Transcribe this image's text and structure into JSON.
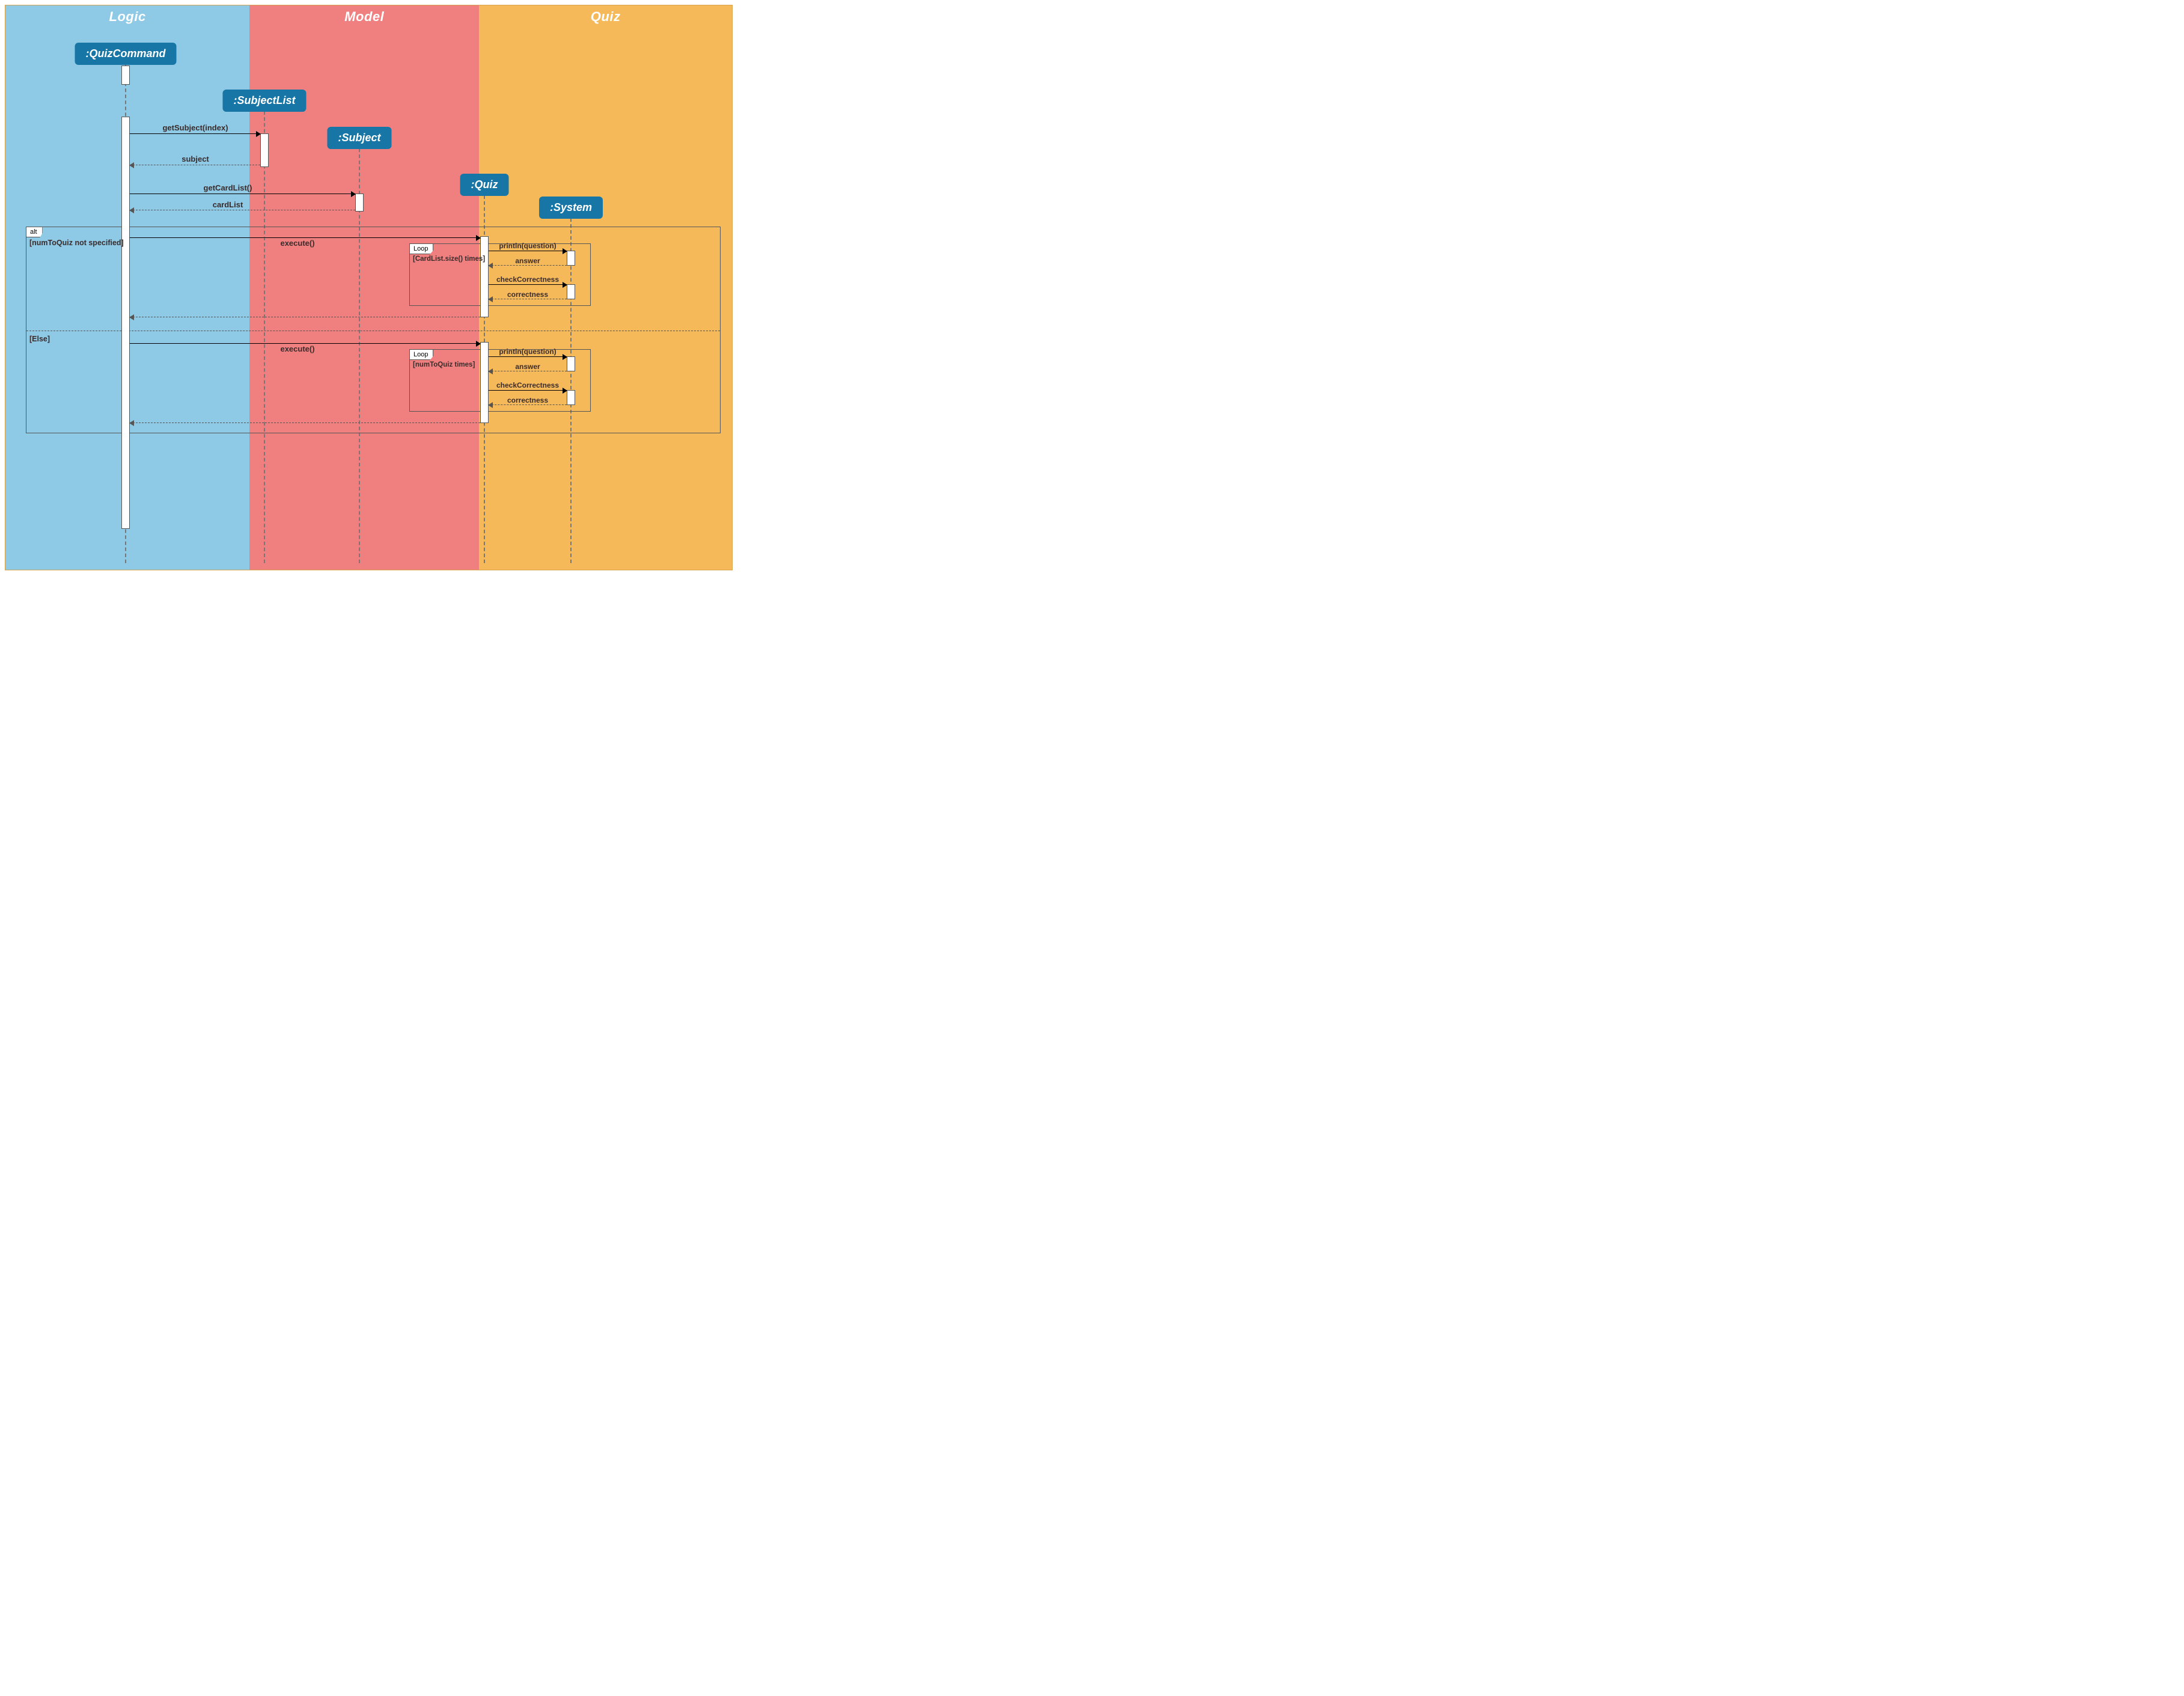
{
  "lanes": {
    "logic": "Logic",
    "model": "Model",
    "quiz": "Quiz"
  },
  "participants": {
    "quizCommand": ":QuizCommand",
    "subjectList": ":SubjectList",
    "subject": ":Subject",
    "quizObj": ":Quiz",
    "system": ":System"
  },
  "messages": {
    "getSubject": "getSubject(index)",
    "subjectRet": "subject",
    "getCardList": "getCardList()",
    "cardListRet": "cardList",
    "execute1": "execute()",
    "execute2": "execute()",
    "println1": "println(question)",
    "println2": "println(question)",
    "answer1": "answer",
    "answer2": "answer",
    "check1": "checkCorrectness",
    "check2": "checkCorrectness",
    "corr1": "correctness",
    "corr2": "correctness"
  },
  "fragments": {
    "altTag": "alt",
    "altGuard1": "[numToQuiz not specified]",
    "altGuard2": "[Else]",
    "loopTag1": "Loop",
    "loopGuard1": "[CardList.size() times]",
    "loopTag2": "Loop",
    "loopGuard2": "[numToQuiz times]"
  }
}
